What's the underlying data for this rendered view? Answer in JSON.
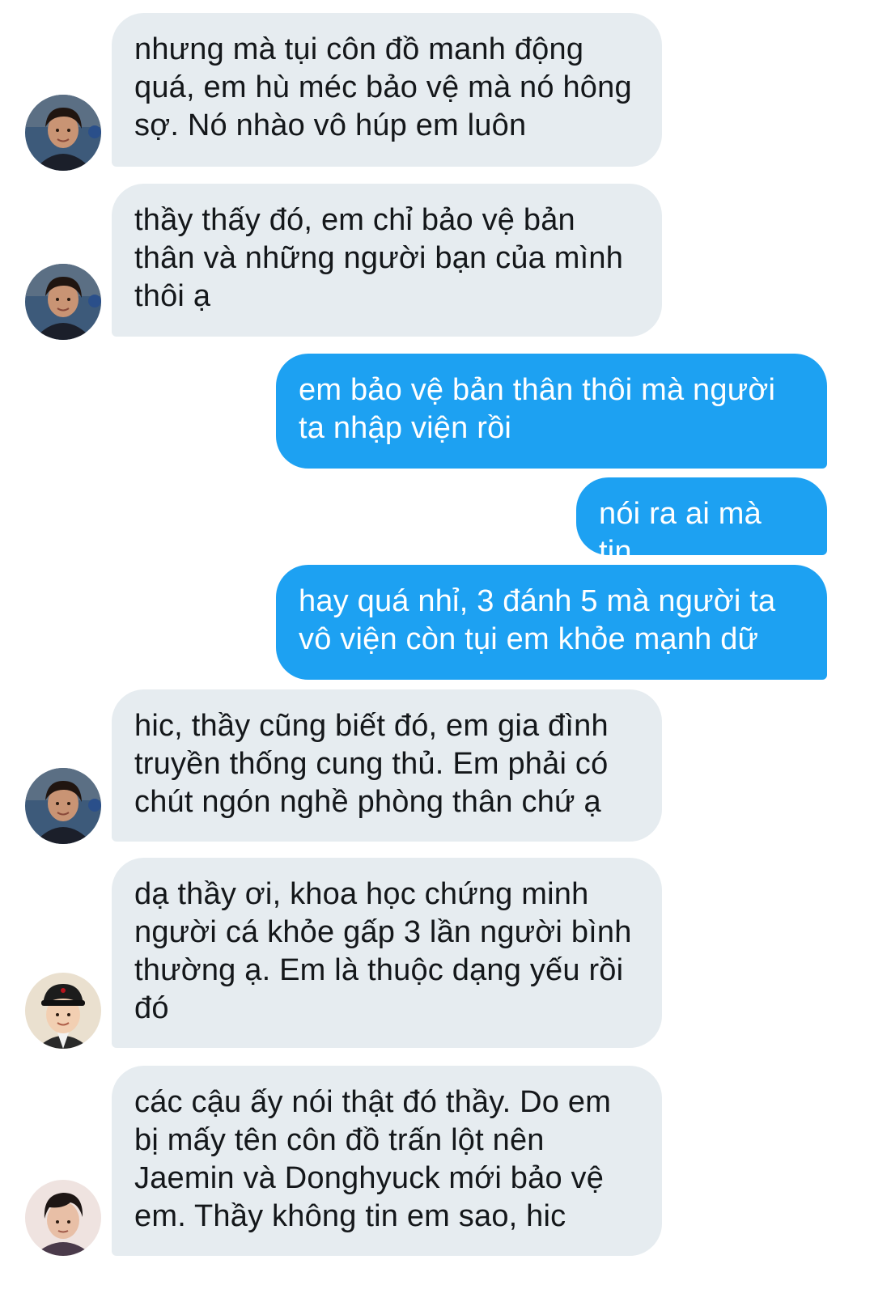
{
  "messages": [
    {
      "direction": "incoming",
      "avatar": "boy-portrait-avatar",
      "text": "nhưng mà tụi côn đồ manh động\nquá, em hù méc bảo vệ mà nó hông\nsợ. Nó nhào vô húp em luôn"
    },
    {
      "direction": "incoming",
      "avatar": "boy-portrait-avatar",
      "text": "thầy thấy đó, em chỉ bảo vệ bản\nthân và những người bạn của mình\nthôi ạ"
    },
    {
      "direction": "outgoing",
      "text": "em bảo vệ bản thân thôi mà người\nta nhập viện rồi"
    },
    {
      "direction": "outgoing",
      "text": "nói ra ai mà tin"
    },
    {
      "direction": "outgoing",
      "text": "hay quá nhỉ, 3 đánh 5 mà người ta\nvô viện còn tụi em khỏe mạnh dữ"
    },
    {
      "direction": "incoming",
      "avatar": "boy-portrait-avatar",
      "text": "hic, thầy cũng biết đó, em gia đình\ntruyền thống cung thủ. Em phải có\nchút ngón nghề phòng thân chứ ạ"
    },
    {
      "direction": "incoming",
      "avatar": "child-hat-avatar",
      "text": "dạ thầy ơi, khoa học chứng minh\nngười cá khỏe gấp 3 lần người bình\nthường ạ. Em là thuộc dạng yếu rồi\nđó"
    },
    {
      "direction": "incoming",
      "avatar": "young-man-avatar",
      "text": "các cậu ấy nói thật đó thầy. Do em\nbị mấy tên côn đồ trấn lột nên\nJaemin và Donghyuck mới bảo vệ\nem. Thầy không tin em sao, hic"
    }
  ],
  "colors": {
    "incoming_bubble": "#e6ecf0",
    "incoming_text": "#14171a",
    "outgoing_bubble": "#1da1f2",
    "outgoing_text": "#ffffff",
    "background": "#ffffff"
  }
}
